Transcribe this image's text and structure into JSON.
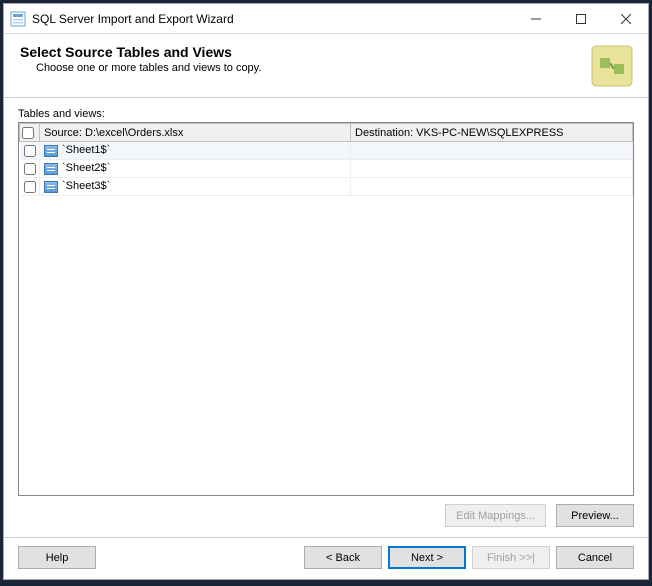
{
  "window": {
    "title": "SQL Server Import and Export Wizard"
  },
  "header": {
    "title": "Select Source Tables and Views",
    "subtitle": "Choose one or more tables and views to copy."
  },
  "tables_label": "Tables and views:",
  "columns": {
    "source": "Source: D:\\excel\\Orders.xlsx",
    "destination": "Destination: VKS-PC-NEW\\SQLEXPRESS"
  },
  "rows": [
    {
      "name": "`Sheet1$`",
      "selected": true
    },
    {
      "name": "`Sheet2$`",
      "selected": false
    },
    {
      "name": "`Sheet3$`",
      "selected": false
    }
  ],
  "buttons": {
    "edit_mappings": "Edit Mappings...",
    "preview": "Preview...",
    "help": "Help",
    "back": "< Back",
    "next": "Next >",
    "finish": "Finish >>|",
    "cancel": "Cancel"
  }
}
